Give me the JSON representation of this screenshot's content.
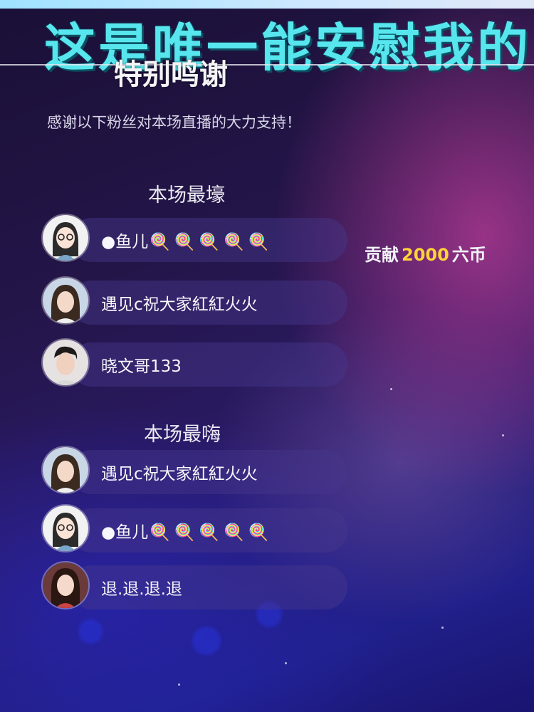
{
  "banner": {
    "headline": "这是唯一能安慰我的",
    "title": "特别鸣谢",
    "subtitle": "感谢以下粉丝对本场直播的大力支持！"
  },
  "sections": [
    {
      "title": "本场最壕",
      "rows": [
        {
          "name": "●鱼儿",
          "emojis": "🍭🍭🍭🍭🍭",
          "avatar": "cartoon-girl-glasses-avatar"
        },
        {
          "name": "遇见c祝大家紅紅火火",
          "emojis": "",
          "avatar": "girl-photo-avatar"
        },
        {
          "name": "晓文哥133",
          "emojis": "",
          "avatar": "boy-photo-avatar"
        }
      ]
    },
    {
      "title": "本场最嗨",
      "rows": [
        {
          "name": "遇见c祝大家紅紅火火",
          "emojis": "",
          "avatar": "girl-photo-avatar"
        },
        {
          "name": "●鱼儿",
          "emojis": "🍭🍭🍭🍭🍭",
          "avatar": "cartoon-girl-glasses-avatar"
        },
        {
          "name": "退.退.退.退",
          "emojis": "",
          "avatar": "woman-photo-avatar"
        }
      ]
    }
  ],
  "contribution": {
    "prefix": "贡献",
    "amount": "2000",
    "unit": "六币"
  },
  "colors": {
    "headline": "#57e6ee",
    "amount": "#ffd23a",
    "pill": "rgba(70,55,140,0.45)"
  }
}
